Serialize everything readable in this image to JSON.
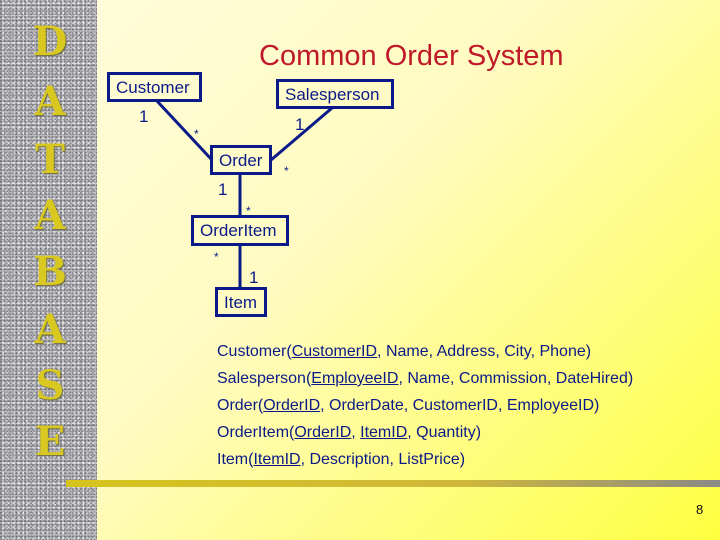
{
  "side_banner": {
    "letters": [
      "D",
      "A",
      "T",
      "A",
      "B",
      "A",
      "S",
      "E"
    ]
  },
  "title": "Common Order System",
  "diagram": {
    "entities": {
      "customer": "Customer",
      "salesperson": "Salesperson",
      "order": "Order",
      "order_item": "OrderItem",
      "item": "Item"
    },
    "multiplicities": {
      "customer_side": "1",
      "order_customer_side": "*",
      "salesperson_side": "1",
      "order_salesperson_side": "*",
      "order_to_orderitem_one": "1",
      "orderitem_from_order_many": "*",
      "orderitem_to_item_many": "*",
      "item_side": "1"
    }
  },
  "schema": [
    {
      "table": "Customer",
      "keys": [
        "CustomerID"
      ],
      "rest": ", Name, Address, City, Phone)"
    },
    {
      "table": "Salesperson",
      "keys": [
        "EmployeeID"
      ],
      "rest": ", Name, Commission, DateHired)"
    },
    {
      "table": "Order",
      "keys": [
        "OrderID"
      ],
      "rest": ", OrderDate, CustomerID, EmployeeID)"
    },
    {
      "table": "OrderItem",
      "keys": [
        "OrderID",
        "ItemID"
      ],
      "rest": ", Quantity)"
    },
    {
      "table": "Item",
      "keys": [
        "ItemID"
      ],
      "rest": ", Description, ListPrice)"
    }
  ],
  "schema_text": {
    "l0": {
      "pre": "Customer(",
      "k0": "CustomerID",
      "post": ", Name, Address, City, Phone)"
    },
    "l1": {
      "pre": "Salesperson(",
      "k0": "EmployeeID",
      "post": ", Name, Commission, DateHired)"
    },
    "l2": {
      "pre": "Order(",
      "k0": "OrderID",
      "post": ", OrderDate, CustomerID, EmployeeID)"
    },
    "l3": {
      "pre": "OrderItem(",
      "k0": "OrderID",
      "mid": ", ",
      "k1": "ItemID",
      "post": ", Quantity)"
    },
    "l4": {
      "pre": "Item(",
      "k0": "ItemID",
      "post": ", Description, ListPrice)"
    }
  },
  "page_number": "8",
  "colors": {
    "title": "#c01a2a",
    "ink": "#0a1a88",
    "banner_letter": "#d8c820"
  }
}
